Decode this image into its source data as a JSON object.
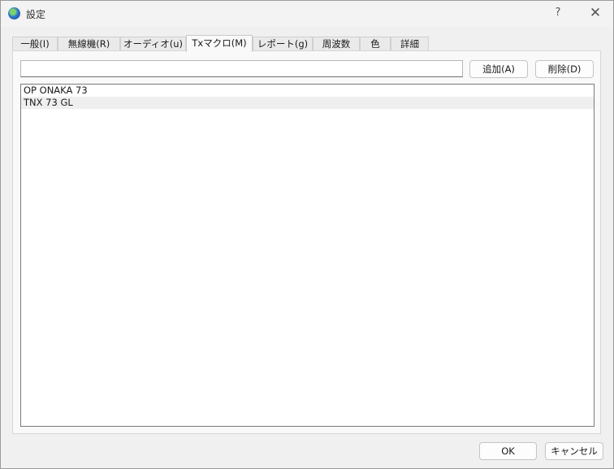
{
  "window": {
    "title": "設定",
    "help_label": "?",
    "close_label": "✕"
  },
  "tabs": [
    {
      "label": "一般(I)",
      "active": false
    },
    {
      "label": "無線機(R)",
      "active": false
    },
    {
      "label": "オーディオ(u)",
      "active": false
    },
    {
      "label": "Txマクロ(M)",
      "active": true
    },
    {
      "label": "レポート(g)",
      "active": false
    },
    {
      "label": "周波数",
      "active": false
    },
    {
      "label": "色",
      "active": false
    },
    {
      "label": "詳細",
      "active": false
    }
  ],
  "macro": {
    "input_value": "",
    "add_label": "追加(A)",
    "delete_label": "削除(D)",
    "items": [
      {
        "text": "OP ONAKA 73",
        "selected": false
      },
      {
        "text": "TNX 73 GL",
        "selected": true
      }
    ]
  },
  "footer": {
    "ok_label": "OK",
    "cancel_label": "キャンセル"
  }
}
